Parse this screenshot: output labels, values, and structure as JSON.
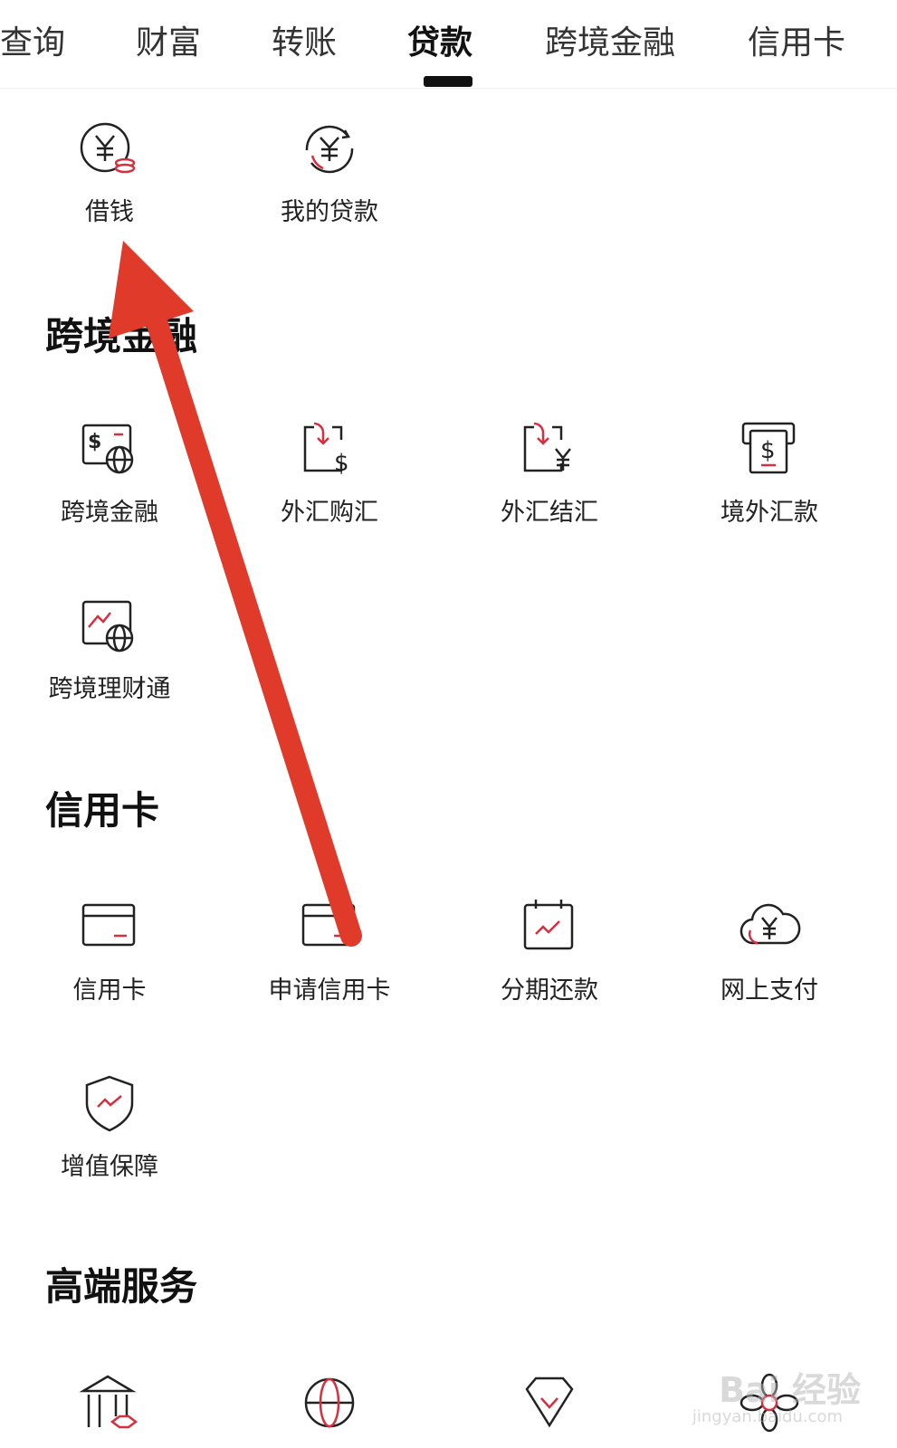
{
  "tabs": [
    {
      "label": "查询"
    },
    {
      "label": "财富"
    },
    {
      "label": "转账"
    },
    {
      "label": "贷款"
    },
    {
      "label": "跨境金融"
    },
    {
      "label": "信用卡"
    }
  ],
  "active_tab": "贷款",
  "loan": {
    "items": [
      {
        "label": "借钱",
        "icon": "yen-coin-icon"
      },
      {
        "label": "我的贷款",
        "icon": "yen-refresh-icon"
      }
    ]
  },
  "cross_border": {
    "title": "跨境金融",
    "items": [
      {
        "label": "跨境金融",
        "icon": "dollar-globe-icon"
      },
      {
        "label": "外汇购汇",
        "icon": "dollar-exchange-icon"
      },
      {
        "label": "外汇结汇",
        "icon": "yen-exchange-icon"
      },
      {
        "label": "境外汇款",
        "icon": "overseas-remit-icon"
      },
      {
        "label": "跨境理财通",
        "icon": "wealth-globe-icon"
      }
    ]
  },
  "credit_card": {
    "title": "信用卡",
    "items": [
      {
        "label": "信用卡",
        "icon": "card-icon"
      },
      {
        "label": "申请信用卡",
        "icon": "card-apply-icon"
      },
      {
        "label": "分期还款",
        "icon": "calendar-chart-icon"
      },
      {
        "label": "网上支付",
        "icon": "cloud-yen-icon"
      },
      {
        "label": "增值保障",
        "icon": "shield-chart-icon"
      }
    ]
  },
  "premium": {
    "title": "高端服务",
    "items": [
      {
        "icon": "bank-building-icon"
      },
      {
        "icon": "globe-icon"
      },
      {
        "icon": "diamond-icon"
      },
      {
        "icon": "flower-icon"
      }
    ]
  },
  "watermark": {
    "text": "Bai 经验",
    "url": "jingyan.baidu.com"
  },
  "colors": {
    "accent": "#d6303f",
    "annotation_arrow": "#e03a2b",
    "text": "#222222"
  }
}
